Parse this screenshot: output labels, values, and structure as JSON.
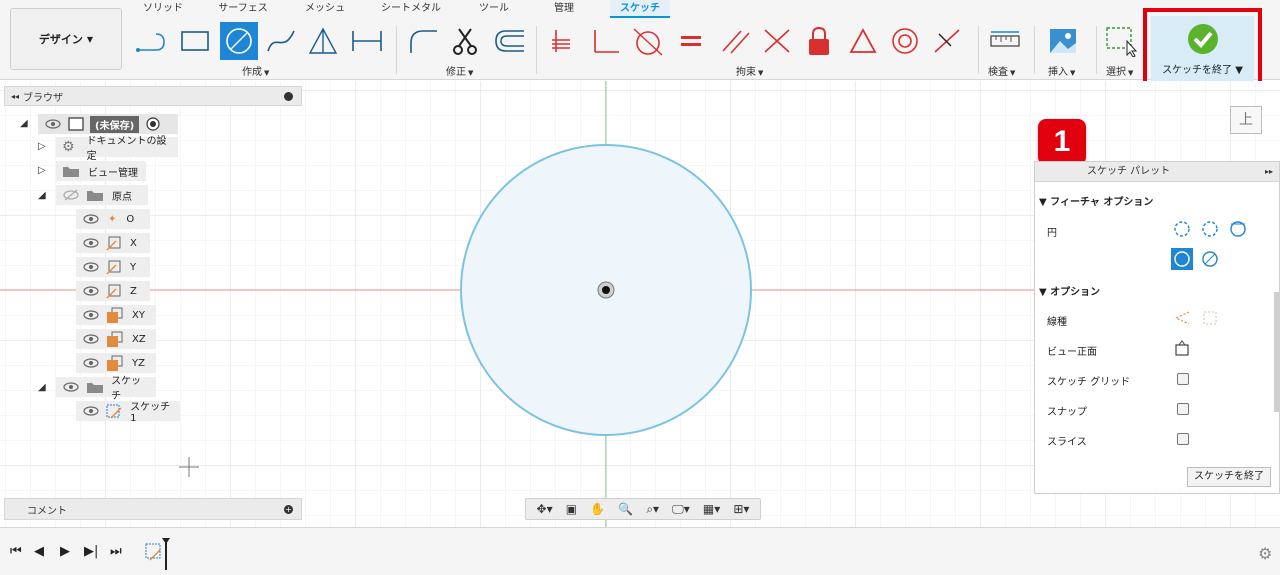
{
  "toolbar": {
    "workspace_button": "デザイン",
    "tabs": [
      "ソリッド",
      "サーフェス",
      "メッシュ",
      "シートメタル",
      "ツール",
      "管理",
      "スケッチ"
    ],
    "active_tab": "スケッチ",
    "groups": {
      "create": "作成",
      "modify": "修正",
      "constrain": "拘束",
      "inspect": "検査",
      "insert": "挿入",
      "select": "選択"
    },
    "finish_sketch": "スケッチを終了"
  },
  "browser": {
    "title": "ブラウザ",
    "root": "(未保存)",
    "items": {
      "doc_settings": "ドキュメントの設定",
      "named_views": "ビュー管理",
      "origin": "原点",
      "o": "O",
      "x": "X",
      "y": "Y",
      "z": "Z",
      "xy": "XY",
      "xz": "XZ",
      "yz": "YZ",
      "sketches": "スケッチ",
      "sketch1": "スケッチ1"
    }
  },
  "comment_bar": "コメント",
  "viewcube_face": "上",
  "callout_number": "1",
  "palette": {
    "title": "スケッチ パレット",
    "feature_options": "フィーチャ オプション",
    "circle_label": "円",
    "options": "オプション",
    "linetype": "線種",
    "look_at": "ビュー正面",
    "sketch_grid": "スケッチ グリッド",
    "snap": "スナップ",
    "slice": "スライス",
    "finish_button": "スケッチを終了"
  },
  "colors": {
    "accent": "#0696d7",
    "selected_tool": "#1e86d4",
    "callout_red": "#e0000e",
    "finish_bg": "#d7ecf7",
    "circle_stroke": "#7cc3e2",
    "circle_fill": "#eef6fc",
    "constraint_red": "#d9302f"
  }
}
